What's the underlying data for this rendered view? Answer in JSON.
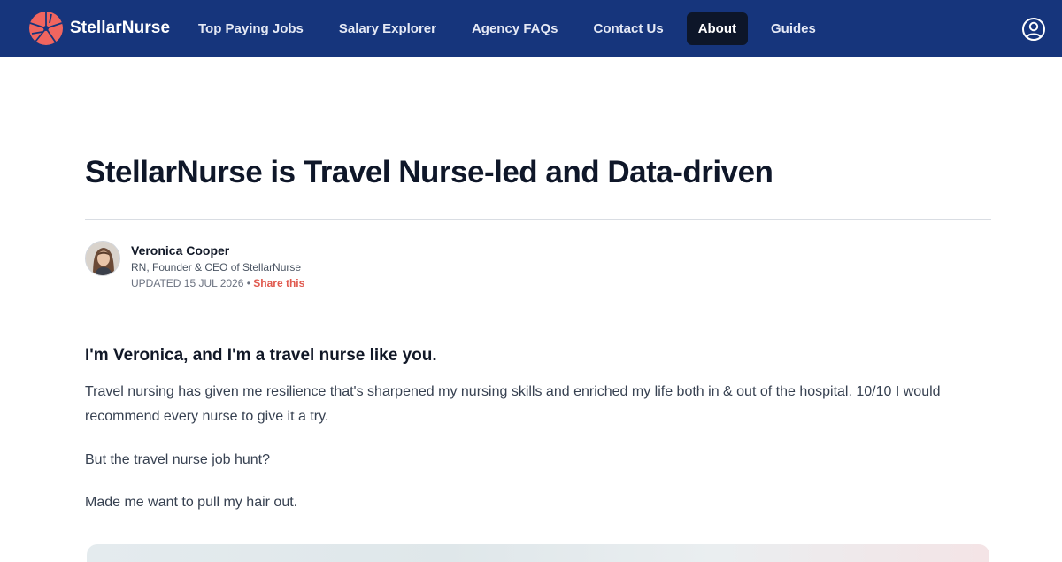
{
  "header": {
    "brand": "StellarNurse",
    "nav": [
      {
        "label": "Top Paying Jobs"
      },
      {
        "label": "Salary Explorer"
      },
      {
        "label": "Agency FAQs"
      },
      {
        "label": "Contact Us"
      },
      {
        "label": "About",
        "active": true
      },
      {
        "label": "Guides"
      }
    ],
    "user_icon": "user-circle-icon"
  },
  "article": {
    "title": "StellarNurse is Travel Nurse-led and Data-driven",
    "author": {
      "name": "Veronica Cooper",
      "role": "RN, Founder & CEO of StellarNurse",
      "updated": "UPDATED 15 JUL 2026",
      "separator": "•",
      "share_label": "Share this"
    },
    "intro_heading": "I'm Veronica, and I'm a travel nurse like you.",
    "paragraphs": [
      "Travel nursing has given me resilience that's sharpened my nursing skills and enriched my life both in & out of the hospital. 10/10 I would recommend every nurse to give it a try.",
      "But the travel nurse job hunt?",
      "Made me want to pull my hair out."
    ]
  },
  "colors": {
    "nav_bg": "#16357c",
    "nav_active_bg": "#0d1629",
    "logo_accent": "#f0655f",
    "share_link": "#e05a4f"
  }
}
